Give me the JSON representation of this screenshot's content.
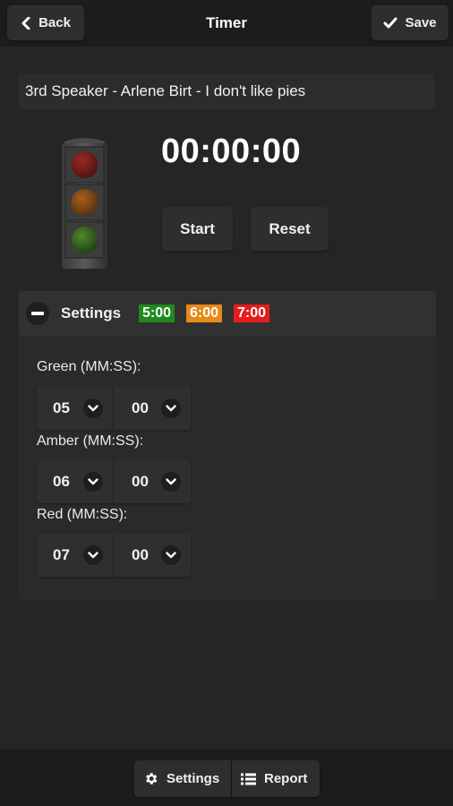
{
  "header": {
    "back_label": "Back",
    "title": "Timer",
    "save_label": "Save"
  },
  "speaker": {
    "value": "3rd Speaker - Arlene Birt - I don't like pies"
  },
  "timer": {
    "display": "00:00:00",
    "start_label": "Start",
    "reset_label": "Reset"
  },
  "settings_panel": {
    "title": "Settings",
    "badges": [
      {
        "label": "5:00",
        "color": "#1e8a1e"
      },
      {
        "label": "6:00",
        "color": "#e8891a"
      },
      {
        "label": "7:00",
        "color": "#e51c1c"
      }
    ],
    "fields": [
      {
        "label": "Green (MM:SS):",
        "minutes": "05",
        "seconds": "00"
      },
      {
        "label": "Amber (MM:SS):",
        "minutes": "06",
        "seconds": "00"
      },
      {
        "label": "Red (MM:SS):",
        "minutes": "07",
        "seconds": "00"
      }
    ]
  },
  "footer": {
    "settings_label": "Settings",
    "report_label": "Report"
  },
  "icons": {
    "back": "chevron-left-icon",
    "save": "check-icon",
    "collapse": "minus-icon",
    "dropdown": "chevron-down-icon",
    "settings": "gear-icon",
    "report": "list-icon"
  },
  "colors": {
    "background": "#252525",
    "bar": "#1c1c1c",
    "green": "#1e8a1e",
    "amber": "#e8891a",
    "red": "#e51c1c"
  }
}
